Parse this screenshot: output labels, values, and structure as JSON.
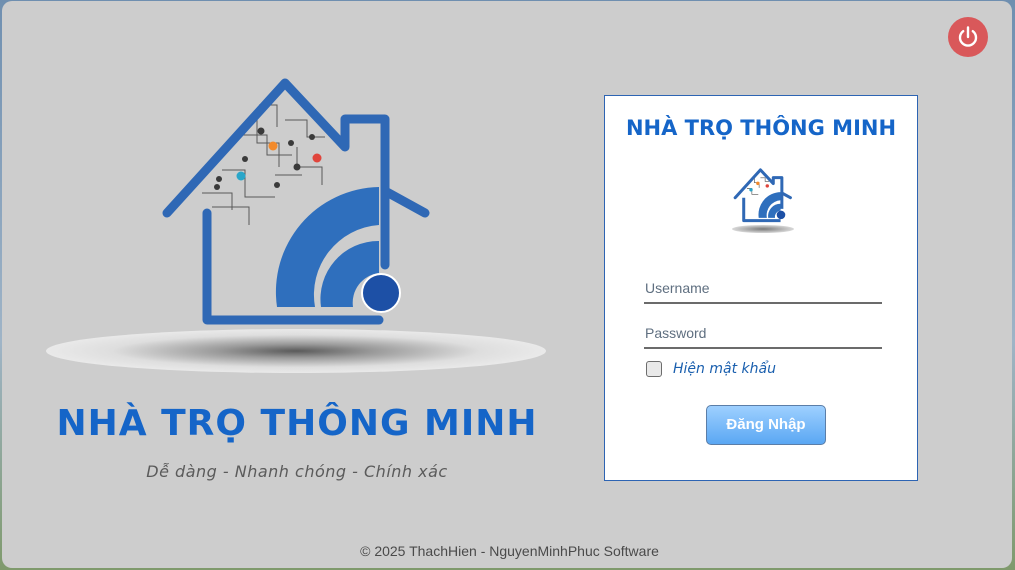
{
  "app": {
    "brand_title": "NHÀ TRỌ THÔNG MINH",
    "tagline": "Dễ dàng - Nhanh chóng - Chính xác"
  },
  "window_controls": {
    "power_icon": "power-icon"
  },
  "login": {
    "title": "NHÀ TRỌ THÔNG MINH",
    "username": {
      "value": "",
      "placeholder": "Username"
    },
    "password": {
      "value": "",
      "placeholder": "Password"
    },
    "show_password": {
      "label": "Hiện mật khẩu",
      "checked": false
    },
    "submit_label": "Đăng Nhập"
  },
  "footer": {
    "copyright": "© 2025 ThachHien - NguyenMinhPhuc Software"
  },
  "colors": {
    "brand_blue": "#1565c8",
    "logo_blue": "#2f68b5",
    "power_red": "#d9585a",
    "button_blue": "#5aa7f3",
    "window_bg": "#cdcdcd"
  }
}
